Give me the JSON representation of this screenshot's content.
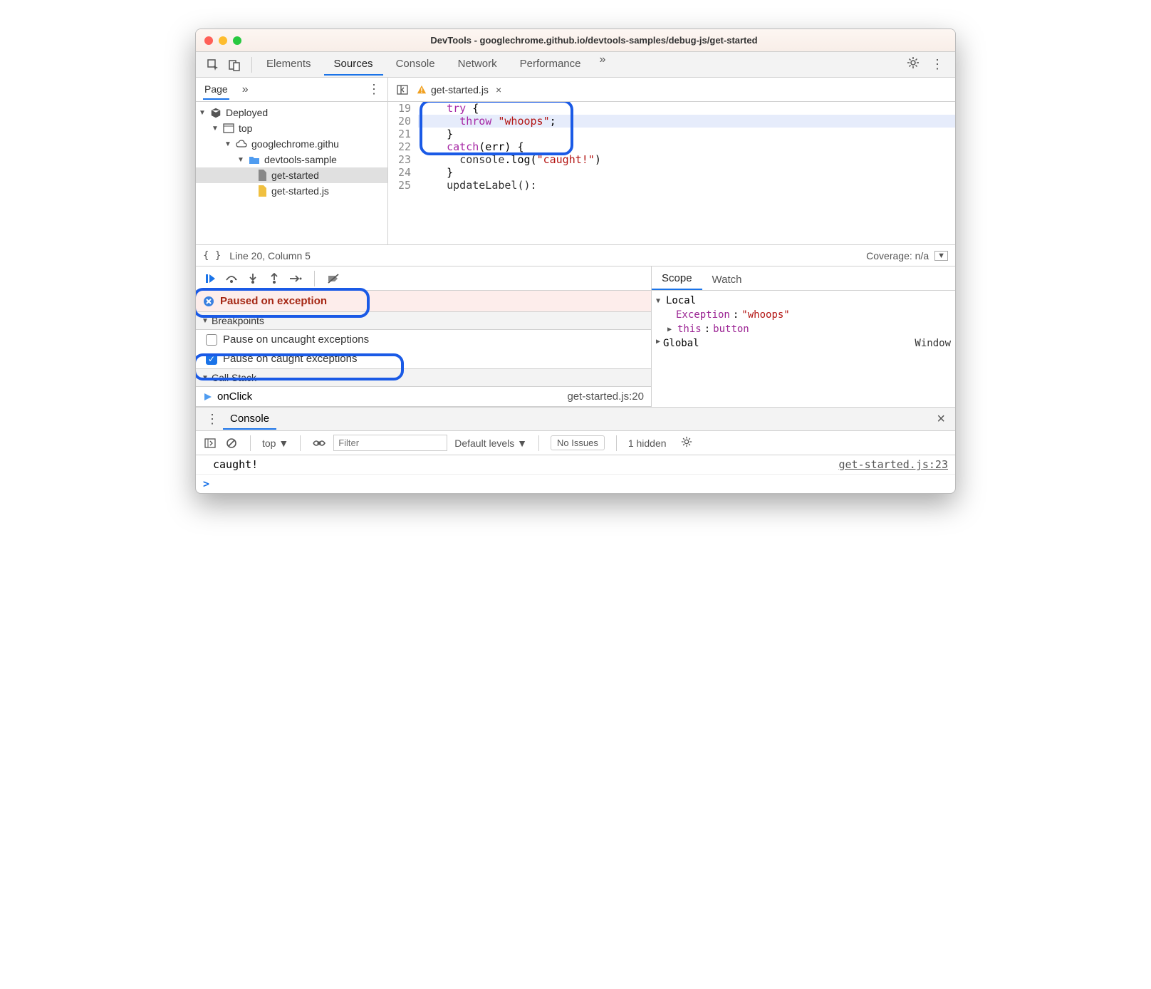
{
  "window": {
    "title": "DevTools - googlechrome.github.io/devtools-samples/debug-js/get-started",
    "traffic_colors": [
      "#ff5f57",
      "#febc2e",
      "#28c840"
    ]
  },
  "toolbar": {
    "tabs": [
      "Elements",
      "Sources",
      "Console",
      "Network",
      "Performance"
    ],
    "active_tab": "Sources",
    "overflow": "»"
  },
  "sidebar": {
    "page_tab": "Page",
    "overflow": "»",
    "tree": {
      "root": "Deployed",
      "top": "top",
      "domain": "googlechrome.githu",
      "folder": "devtools-sample",
      "file_html": "get-started",
      "file_js": "get-started.js"
    }
  },
  "editor": {
    "filename": "get-started.js",
    "close": "×",
    "lines": [
      {
        "n": "19",
        "indent": "    ",
        "tokens": [
          {
            "t": "try",
            "c": "kw"
          },
          {
            "t": " {",
            "c": ""
          }
        ]
      },
      {
        "n": "20",
        "indent": "      ",
        "tokens": [
          {
            "t": "throw",
            "c": "kw"
          },
          {
            "t": " ",
            "c": ""
          },
          {
            "t": "\"whoops\"",
            "c": "str"
          },
          {
            "t": ";",
            "c": ""
          }
        ],
        "hl": true
      },
      {
        "n": "21",
        "indent": "    ",
        "tokens": [
          {
            "t": "}",
            "c": ""
          }
        ]
      },
      {
        "n": "22",
        "indent": "    ",
        "tokens": [
          {
            "t": "catch",
            "c": "kw"
          },
          {
            "t": "(err) {",
            "c": ""
          }
        ]
      },
      {
        "n": "23",
        "indent": "      ",
        "tokens": [
          {
            "t": "console",
            "c": "fn"
          },
          {
            "t": ".log(",
            "c": ""
          },
          {
            "t": "\"caught!\"",
            "c": "str"
          },
          {
            "t": ")",
            "c": ""
          }
        ]
      },
      {
        "n": "24",
        "indent": "    ",
        "tokens": [
          {
            "t": "}",
            "c": ""
          }
        ]
      },
      {
        "n": "25",
        "indent": "    ",
        "tokens": [
          {
            "t": "updateLabel():",
            "c": "fn"
          }
        ]
      }
    ],
    "status": {
      "braces": "{ }",
      "pos": "Line 20, Column 5",
      "coverage": "Coverage: n/a"
    }
  },
  "debugger": {
    "paused_msg": "Paused on exception",
    "breakpoints_header": "Breakpoints",
    "bp_uncaught": "Pause on uncaught exceptions",
    "bp_caught": "Pause on caught exceptions",
    "callstack_header": "Call Stack",
    "callstack": {
      "fn": "onClick",
      "loc": "get-started.js:20"
    }
  },
  "scope": {
    "tabs": [
      "Scope",
      "Watch"
    ],
    "local_label": "Local",
    "exception_key": "Exception",
    "exception_val": "\"whoops\"",
    "this_key": "this",
    "this_val": "button",
    "global_key": "Global",
    "global_val": "Window"
  },
  "console": {
    "tab": "Console",
    "context": "top",
    "filter_placeholder": "Filter",
    "levels": "Default levels",
    "issues": "No Issues",
    "hidden": "1 hidden",
    "log_msg": "caught!",
    "log_src": "get-started.js:23",
    "prompt": ">"
  }
}
